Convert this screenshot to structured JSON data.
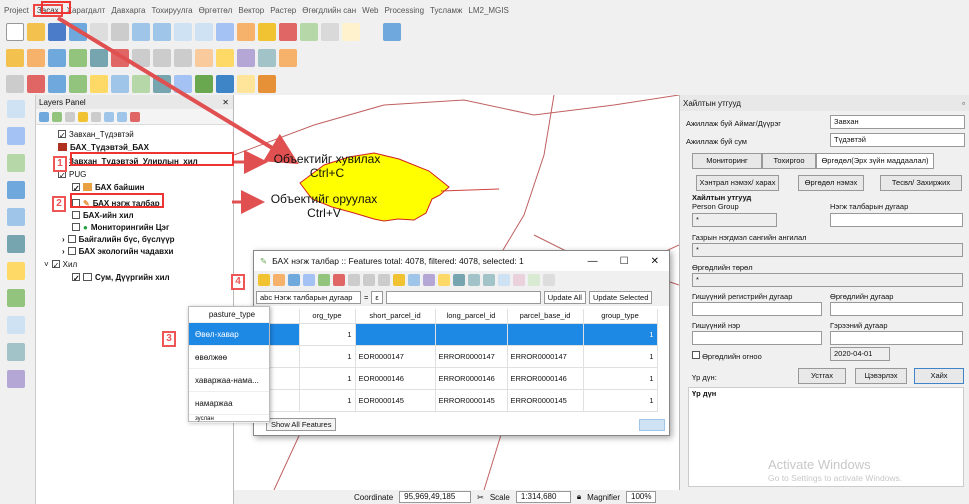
{
  "menu": [
    "Project",
    "Засах",
    "Харагдалт",
    "Давхарга",
    "Тохируулга",
    "Өргөтгөл",
    "Вектор",
    "Растер",
    "Өгөгдлийн сан",
    "Web",
    "Processing",
    "Тусламж",
    "LM2_MGIS"
  ],
  "layers_panel": {
    "title": "Layers Panel",
    "items": [
      {
        "label": "Завхан_Түдэвтэй",
        "checked": true,
        "color": "#ffffff"
      },
      {
        "label": "БАХ_Түдэвтэй_БАХ",
        "checked": false,
        "color": "#b03020"
      },
      {
        "label": "Завхан_Түдэвтэй_Улирлын_хил",
        "checked": true,
        "color": "#ffffff"
      },
      {
        "label": "PUG",
        "checked": true,
        "color": "#ffffff"
      },
      {
        "label": "БАХ байшин",
        "checked": true,
        "color": "#e8a040"
      },
      {
        "label": "БАХ нэгж талбар",
        "checked": false,
        "color": "#ffffff"
      },
      {
        "label": "БАХ-ийн хил",
        "checked": false,
        "color": "#ffffff"
      },
      {
        "label": "Мониторингийн Цэг",
        "checked": false,
        "color": "#20a040"
      },
      {
        "label": "Байгалийн бүс, бүслүүр",
        "checked": false,
        "color": "#ffffff"
      },
      {
        "label": "БАХ экологийн чадавхи",
        "checked": false,
        "color": "#ffffff"
      },
      {
        "label": "Хил",
        "checked": true,
        "color": "#ffffff"
      },
      {
        "label": "Сум, Дүүргийн хил",
        "checked": true,
        "color": "#ffffff"
      }
    ]
  },
  "annotations": {
    "num1": "1",
    "num2": "2",
    "num3": "3",
    "num4": "4",
    "copy_label": "Объектийг хувилах\nCtrl+C",
    "paste_label": "Объектийг оруулах\nCtrl+V"
  },
  "attribute_dialog": {
    "title": "БАХ нэгж талбар :: Features total: 4078, filtered: 4078, selected: 1",
    "field_select": "abc Нэгж талбарын дугаар",
    "equals": "=",
    "epsilon": "ε",
    "update_all": "Update All",
    "update_selected": "Update Selected",
    "show_all": "Show All Features",
    "columns": [
      "org_type",
      "short_parcel_id",
      "long_parcel_id",
      "parcel_base_id",
      "group_type"
    ],
    "rows": [
      [
        "1",
        "",
        "",
        "",
        "1"
      ],
      [
        "1",
        "EOR0000147",
        "ERROR0000147",
        "ERROR0000147",
        "1"
      ],
      [
        "1",
        "EOR0000146",
        "ERROR0000146",
        "ERROR0000146",
        "1"
      ],
      [
        "1",
        "EOR0000145",
        "ERROR0000145",
        "ERROR0000145",
        "1"
      ]
    ]
  },
  "pasture_popup": {
    "header": "pasture_type",
    "items": [
      "Өвөл-хавар",
      "өвөлжөө",
      "хаваржаа-нама...",
      "намаржаа",
      "зуслан"
    ],
    "selected_index": 0
  },
  "right_panel": {
    "title": "Хайлтын утгууд",
    "aimag_label": "Ажиллаж буй Аймаг/Дүүрэг",
    "aimag_value": "Завхан",
    "sum_label": "Ажиллаж буй сум",
    "sum_value": "Түдэвтэй",
    "tabs": [
      "Мониторинг",
      "Тохиргоо",
      "Өргөдөл(Эрх зүйн маддаалал)"
    ],
    "subbuttons": [
      "Хэнтрал нэмэх/ харах",
      "Өргөдөл нэмэх",
      "Тесвл/ Захиржих"
    ],
    "group_title": "Хайлтын утгууд",
    "person_group_label": "Person Group",
    "person_group_value": "*",
    "parcel_no_label": "Нэгж талбарын дугаар",
    "db_class_label": "Газрын нэгдмэл сангийн ангилал",
    "db_class_value": "*",
    "app_type_label": "Өргөдлийн төрөл",
    "app_type_value": "*",
    "citizen_reg_label": "Гишүүний регистрийн дугаар",
    "app_no_label": "Өргөдлийн дугаар",
    "member_name_label": "Гишүүний нэр",
    "contract_no_label": "Гэрээний дугаар",
    "app_date_label": "Өргөдлийн огноо",
    "app_date_value": "2020-04-01",
    "result_label": "Үр дүн:",
    "clear_btn": "Устгах",
    "refresh_btn": "Цэвэрлэх",
    "search_btn": "Хайх",
    "result_box_title": "Үр дүн"
  },
  "watermark": {
    "line1": "Activate Windows",
    "line2": "Go to Settings to activate Windows."
  },
  "statusbar": {
    "coordinate_label": "Coordinate",
    "coordinate_value": "95,969,49,185",
    "scale_label": "Scale",
    "scale_value": "1:314,680",
    "magnifier_label": "Magnifier",
    "magnifier_value": "100%"
  }
}
